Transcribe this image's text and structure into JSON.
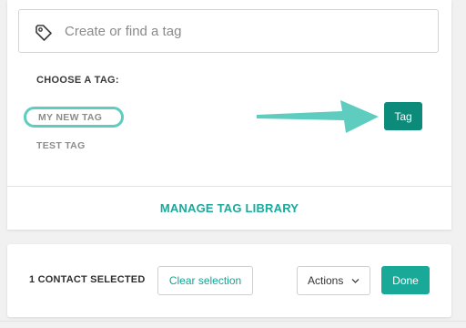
{
  "search": {
    "placeholder": "Create or find a tag",
    "icon": "tag-icon"
  },
  "tags": {
    "heading": "CHOOSE A TAG:",
    "options": [
      {
        "label": "MY NEW TAG",
        "selected": true
      },
      {
        "label": "TEST TAG",
        "selected": false
      }
    ],
    "apply_button": "Tag",
    "manage_link": "MANAGE TAG LIBRARY"
  },
  "bulk_bar": {
    "selected_count": "1 CONTACT SELECTED",
    "clear_label": "Clear selection",
    "actions_label": "Actions",
    "done_label": "Done"
  },
  "colors": {
    "accent": "#18a999",
    "tag_button": "#0c8a7a",
    "arrow": "#5ecdbf",
    "selected_outline": "#5ecdbf"
  }
}
